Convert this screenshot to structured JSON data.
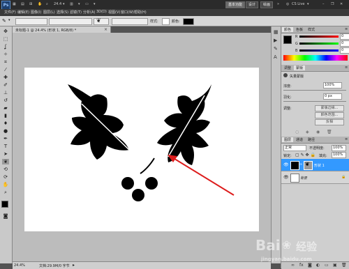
{
  "titlebar": {
    "app_logo": "Ps",
    "zoom": "24.4",
    "workspace_buttons": [
      "基本功能",
      "设计",
      "绘画"
    ],
    "more": "»",
    "cslive": "CS Live"
  },
  "menu": [
    "文件(F)",
    "编辑(E)",
    "图像(I)",
    "图层(L)",
    "选择(S)",
    "滤镜(T)",
    "分析(A)",
    "3D(D)",
    "视图(V)",
    "窗口(W)",
    "帮助(H)"
  ],
  "options": {
    "mode_label": "模式:",
    "opacity_label": "不透明度:",
    "style_label": "样式:",
    "color_label": "颜色:"
  },
  "document": {
    "tab_title": "未标题-1 @ 24.4% (形状 1, RGB/8) *",
    "status_zoom": "24.4%",
    "status_doc": "文档:29.9M/0 字节"
  },
  "color_panel": {
    "tabs": [
      "颜色",
      "色板",
      "样式"
    ],
    "channels": [
      {
        "name": "R",
        "value": "0"
      },
      {
        "name": "G",
        "value": "0"
      },
      {
        "name": "B",
        "value": "0"
      }
    ]
  },
  "adjust_panel": {
    "tabs": [
      "调整",
      "蒙版"
    ],
    "title": "矢量蒙版",
    "density_label": "浓度:",
    "density_value": "100%",
    "feather_label": "羽化:",
    "feather_value": "0 px",
    "refine_label": "调整:",
    "buttons": [
      "蒙版边缘...",
      "颜色范围...",
      "反相"
    ]
  },
  "layers_panel": {
    "tabs": [
      "图层",
      "通道",
      "路径"
    ],
    "blend_mode": "正常",
    "opacity_label": "不透明度:",
    "opacity_value": "100%",
    "lock_label": "锁定:",
    "fill_label": "填充:",
    "fill_value": "100%",
    "layers": [
      {
        "name": "形状 1",
        "selected": true
      },
      {
        "name": "背景",
        "selected": false
      }
    ]
  },
  "watermark": {
    "brand": "Bai",
    "brand_suffix": "经验",
    "url": "jingyan.baidu.com"
  },
  "colors": {
    "accent_selected": "#3399ff",
    "annotation_arrow": "#dd1c1c",
    "shape_fill": "#000000"
  }
}
